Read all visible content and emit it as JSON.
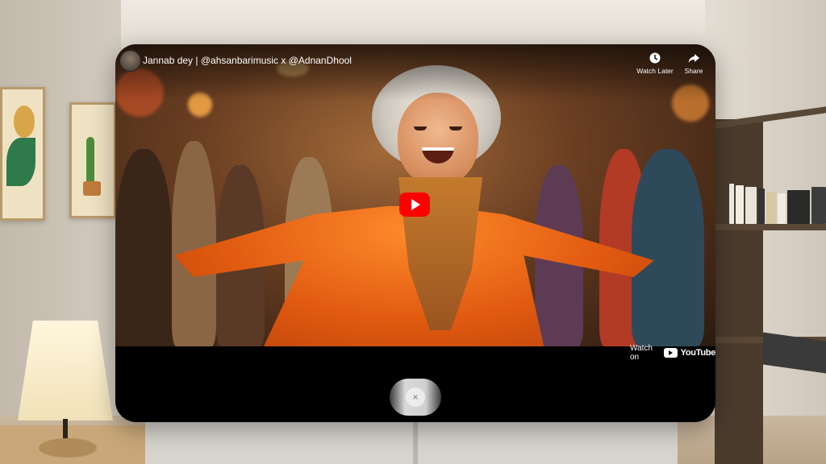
{
  "video": {
    "title": "Jannab dey | @ahsanbarimusic x @AdnanDhool",
    "actions": {
      "watch_later": "Watch Later",
      "share": "Share"
    },
    "watch_on": "Watch on",
    "brand": "YouTube"
  },
  "controls": {
    "close_symbol": "×"
  },
  "colors": {
    "play_button": "#ff0000",
    "window_bg": "#000000"
  },
  "icons": [
    "clock-icon",
    "share-icon",
    "play-icon",
    "youtube-logo-icon",
    "close-icon"
  ]
}
